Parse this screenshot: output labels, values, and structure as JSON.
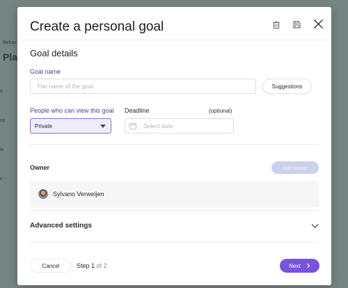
{
  "background": {
    "breadcrumb": "Behav",
    "title": "Pla",
    "side_items": [
      "o",
      "nc",
      "ix",
      "s -"
    ]
  },
  "modal": {
    "title": "Create a personal goal",
    "icons": {
      "delete": "trash-icon",
      "save": "save-icon",
      "close": "close-icon"
    },
    "goal_details": {
      "heading": "Goal details",
      "goal_name_label": "Goal name",
      "goal_name_placeholder": "The name of the goal",
      "suggestions_button": "Suggestions",
      "viewers_label": "People who can view this goal",
      "viewers_value": "Private",
      "deadline_label": "Deadline",
      "deadline_optional": "(optional)",
      "deadline_placeholder": "Select date"
    },
    "owner": {
      "label": "Owner",
      "add_owner_button": "Add owner",
      "name": "Sylvano Verweijen"
    },
    "advanced": {
      "label": "Advanced settings"
    },
    "footer": {
      "cancel_button": "Cancel",
      "step_prefix": "Step ",
      "step_current": "1",
      "step_total": " of 2",
      "next_button": "Next"
    }
  },
  "colors": {
    "accent": "#7a52e0",
    "select_bg": "#f1ecfb",
    "label": "#4a3f8f",
    "disabled_button": "#c9d2ea"
  }
}
